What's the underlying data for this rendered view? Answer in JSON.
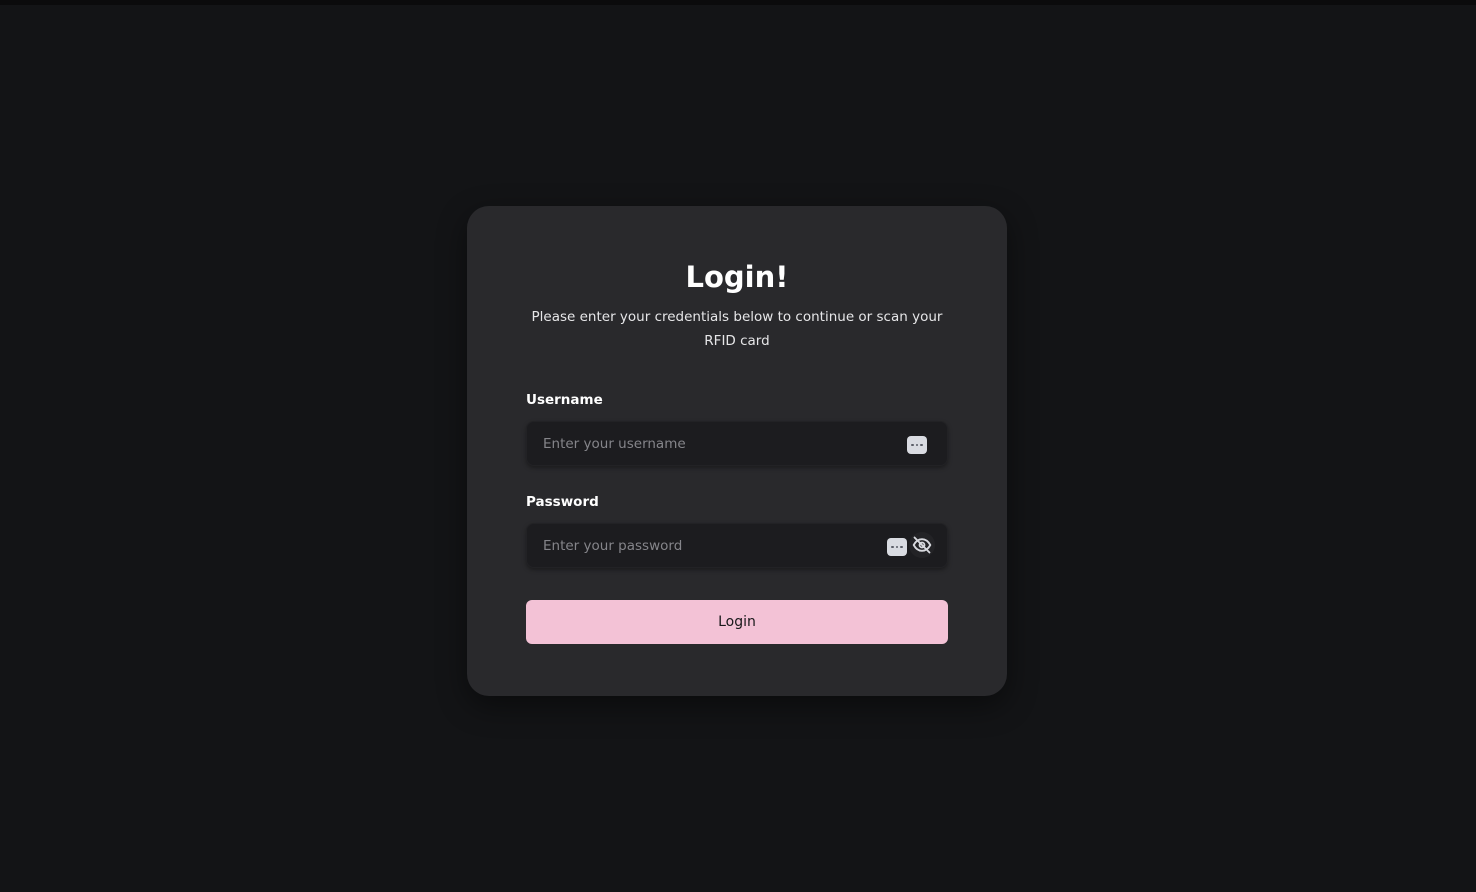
{
  "login": {
    "title": "Login!",
    "subtitle_line1": "Please enter your credentials below to continue or scan your",
    "subtitle_line2": "RFID card",
    "username": {
      "label": "Username",
      "placeholder": "Enter your username",
      "value": ""
    },
    "password": {
      "label": "Password",
      "placeholder": "Enter your password",
      "value": ""
    },
    "submit_label": "Login"
  },
  "icons": {
    "username_field_icon": "password-manager-icon",
    "password_field_icon": "password-manager-icon",
    "password_toggle_icon": "eye-off-icon"
  },
  "colors": {
    "background": "#131416",
    "card": "#29292c",
    "input": "#1c1c1f",
    "accent_button": "#f3c2d6"
  }
}
